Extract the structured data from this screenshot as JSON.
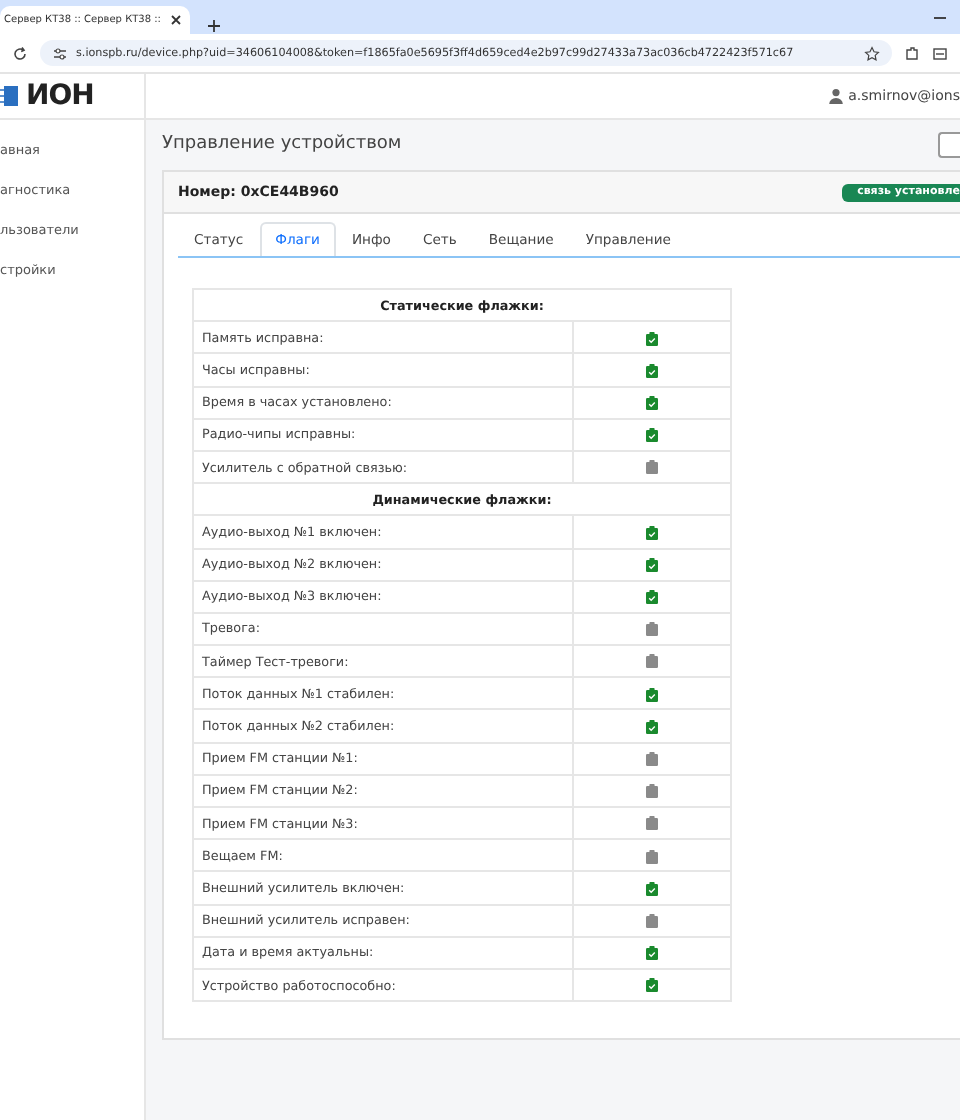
{
  "browser": {
    "tab_title": "Сервер КТ38 :: Сервер КТ38 ::",
    "address": "s.ionspb.ru/device.php?uid=34606104008&token=f1865fa0e5695f3ff4d659ced4e2b97c99d27433a73ac036cb4722423f571c67"
  },
  "header": {
    "logo": "ИОН",
    "user": "a.smirnov@ions"
  },
  "sidebar": {
    "items": [
      {
        "label": "авная",
        "selected": false
      },
      {
        "label": "агностика",
        "selected": false
      },
      {
        "label": "льзователи",
        "selected": false
      },
      {
        "label": "стройки",
        "selected": false
      }
    ]
  },
  "page_title": "Управление устройством",
  "card": {
    "number": "Номер: 0xCE44B960",
    "status": "связь установле"
  },
  "tabs": [
    {
      "label": "Статус",
      "selected": false
    },
    {
      "label": "Флаги",
      "selected": true
    },
    {
      "label": "Инфо",
      "selected": false
    },
    {
      "label": "Сеть",
      "selected": false
    },
    {
      "label": "Вещание",
      "selected": false
    },
    {
      "label": "Управление",
      "selected": false
    }
  ],
  "flags": [
    {
      "kind": "section",
      "label": "Статические флажки:"
    },
    {
      "kind": "flag",
      "label": "Память исправна:",
      "checked": true
    },
    {
      "kind": "flag",
      "label": "Часы исправны:",
      "checked": true
    },
    {
      "kind": "flag",
      "label": "Время в часах установлено:",
      "checked": true
    },
    {
      "kind": "flag",
      "label": "Радио-чипы исправны:",
      "checked": true
    },
    {
      "kind": "flag",
      "label": "Усилитель с обратной связью:",
      "checked": false
    },
    {
      "kind": "section",
      "label": "Динамические флажки:"
    },
    {
      "kind": "flag",
      "label": "Аудио-выход №1 включен:",
      "checked": true
    },
    {
      "kind": "flag",
      "label": "Аудио-выход №2 включен:",
      "checked": true
    },
    {
      "kind": "flag",
      "label": "Аудио-выход №3 включен:",
      "checked": true
    },
    {
      "kind": "flag",
      "label": "Тревога:",
      "checked": false
    },
    {
      "kind": "flag",
      "label": "Таймер Тест-тревоги:",
      "checked": false
    },
    {
      "kind": "flag",
      "label": "Поток данных №1 стабилен:",
      "checked": true
    },
    {
      "kind": "flag",
      "label": "Поток данных №2 стабилен:",
      "checked": true
    },
    {
      "kind": "flag",
      "label": "Прием FM станции №1:",
      "checked": false
    },
    {
      "kind": "flag",
      "label": "Прием FM станции №2:",
      "checked": false
    },
    {
      "kind": "flag",
      "label": "Прием FM станции №3:",
      "checked": false
    },
    {
      "kind": "flag",
      "label": "Вещаем FM:",
      "checked": false
    },
    {
      "kind": "flag",
      "label": "Внешний усилитель включен:",
      "checked": true
    },
    {
      "kind": "flag",
      "label": "Внешний усилитель исправен:",
      "checked": false
    },
    {
      "kind": "flag",
      "label": "Дата и время актуальны:",
      "checked": true
    },
    {
      "kind": "flag",
      "label": "Устройство работоспособно:",
      "checked": true
    }
  ]
}
